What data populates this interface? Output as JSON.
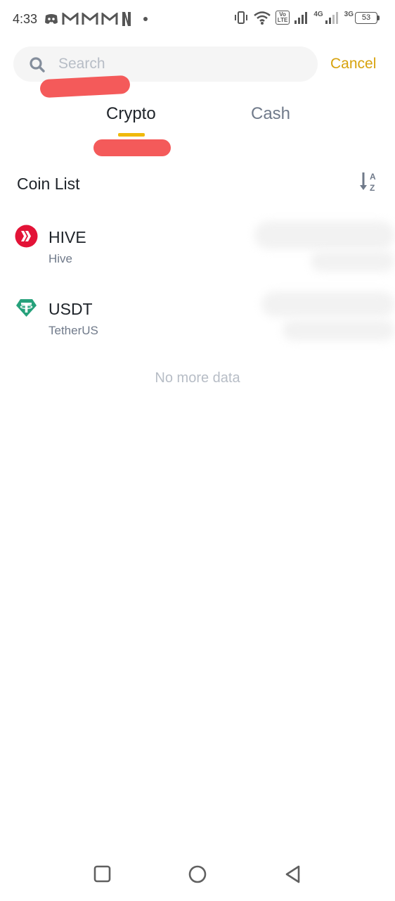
{
  "status_bar": {
    "time": "4:33",
    "left_icons": [
      "discord-icon",
      "gmail-icon",
      "gmail-icon",
      "gmail-icon",
      "netflix-icon",
      "dot-icon"
    ],
    "volte_label": "Vo\nLTE",
    "net_4g": "4G",
    "net_3g": "3G",
    "battery": "53"
  },
  "search": {
    "placeholder": "Search",
    "value": "",
    "cancel_label": "Cancel"
  },
  "tabs": [
    {
      "label": "Crypto",
      "active": true
    },
    {
      "label": "Cash",
      "active": false
    }
  ],
  "coin_list": {
    "title": "Coin List",
    "sort_icon": "sort-az-icon",
    "items": [
      {
        "symbol": "HIVE",
        "name": "Hive",
        "icon": "hive-icon",
        "icon_color": "#e31337"
      },
      {
        "symbol": "USDT",
        "name": "TetherUS",
        "icon": "tether-icon",
        "icon_color": "#26a17b"
      }
    ],
    "footer": "No more data"
  },
  "colors": {
    "accent": "#f0b90b",
    "cancel": "#d7a20d",
    "primary_text": "#1e2329",
    "secondary_text": "#707a8a",
    "muted_text": "#b7bdc6"
  },
  "nav_bar": [
    "recent-apps-icon",
    "home-icon",
    "back-icon"
  ]
}
